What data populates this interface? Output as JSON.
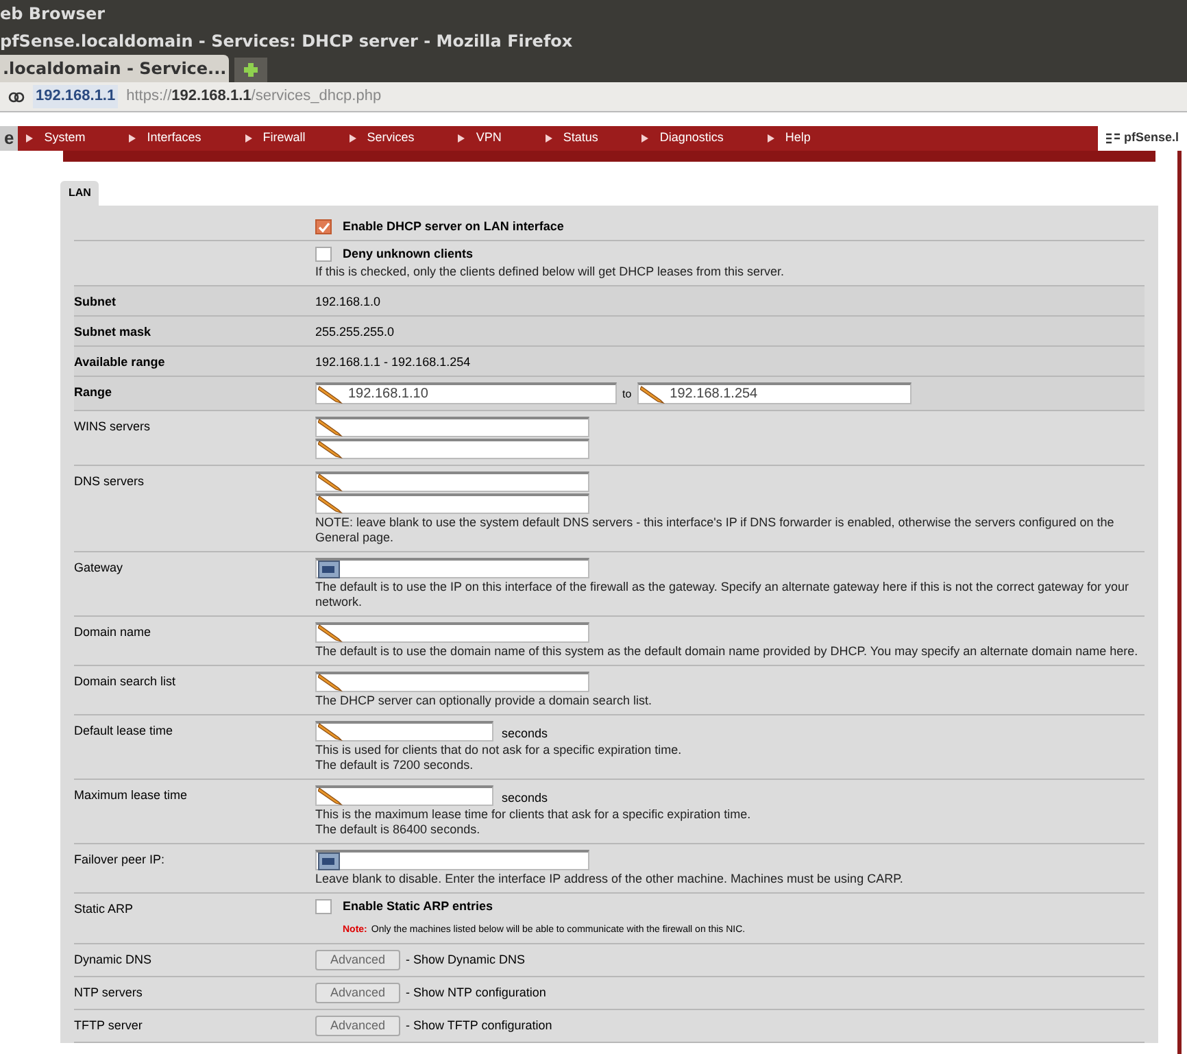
{
  "browser": {
    "app_title": "eb Browser",
    "window_title": "pfSense.localdomain - Services: DHCP server - Mozilla Firefox",
    "tab": ".localdomain - Service...",
    "url_host": "192.168.1.1",
    "url_scheme": "https://",
    "url_domain": "192.168.1.1",
    "url_path": "/services_dhcp.php"
  },
  "nav": {
    "logo": "e",
    "items": [
      "System",
      "Interfaces",
      "Firewall",
      "Services",
      "VPN",
      "Status",
      "Diagnostics",
      "Help"
    ],
    "host": "pfSense.l"
  },
  "tabs": [
    {
      "label": "LAN",
      "selected": true
    }
  ],
  "rows": [
    {
      "kind": "checkbox",
      "checked": true,
      "text": "Enable DHCP server on LAN interface"
    },
    {
      "kind": "checkbox",
      "checked": false,
      "text": "Deny unknown clients",
      "notes": [
        "If this is checked, only the clients defined below will get DHCP leases from this server."
      ]
    },
    {
      "kind": "text",
      "label": "Subnet",
      "required": true,
      "value": "192.168.1.0"
    },
    {
      "kind": "text",
      "label": "Subnet mask",
      "required": true,
      "value": "255.255.255.0"
    },
    {
      "kind": "text",
      "label": "Available range",
      "required": true,
      "value": "192.168.1.1 - 192.168.1.254"
    },
    {
      "kind": "range",
      "label": "Range",
      "required": true,
      "from": "192.168.1.10",
      "joiner": "to",
      "to": "192.168.1.254"
    },
    {
      "kind": "double-input",
      "label": "WINS servers",
      "required": false
    },
    {
      "kind": "double-input",
      "label": "DNS servers",
      "required": false,
      "notes": [
        "NOTE: leave blank to use the system default DNS servers - this interface's IP if DNS forwarder is enabled, otherwise the servers configured on the General page."
      ]
    },
    {
      "kind": "address-input",
      "label": "Gateway",
      "required": false,
      "notes": [
        "The default is to use the IP on this interface of the firewall as the gateway. Specify an alternate gateway here if this is not the correct gateway for your network."
      ]
    },
    {
      "kind": "input",
      "label": "Domain name",
      "required": false,
      "notes": [
        "The default is to use the domain name of this system as the default domain name provided by DHCP. You may specify an alternate domain name here."
      ]
    },
    {
      "kind": "input",
      "label": "Domain search list",
      "required": false,
      "notes": [
        "The DHCP server can optionally provide a domain search list."
      ]
    },
    {
      "kind": "duration",
      "label": "Default lease time",
      "required": false,
      "unit": "seconds",
      "notes": [
        "This is used for clients that do not ask for a specific expiration time.",
        "The default is 7200 seconds."
      ]
    },
    {
      "kind": "duration",
      "label": "Maximum lease time",
      "required": false,
      "unit": "seconds",
      "notes": [
        "This is the maximum lease time for clients that ask for a specific expiration time.",
        "The default is 86400 seconds."
      ]
    },
    {
      "kind": "address-input",
      "label": "Failover peer IP:",
      "required": false,
      "notes": [
        "Leave blank to disable. Enter the interface IP address of the other machine. Machines must be using CARP."
      ]
    },
    {
      "kind": "checkbox",
      "label": "Static ARP",
      "required": false,
      "checked": false,
      "text": "Enable Static ARP entries",
      "warning_label": "Note:",
      "warning": "Only the machines listed below will be able to communicate with the firewall on this NIC."
    },
    {
      "kind": "advanced",
      "label": "Dynamic DNS",
      "required": false,
      "button": "Advanced",
      "text": "- Show Dynamic DNS"
    },
    {
      "kind": "advanced",
      "label": "NTP servers",
      "required": false,
      "button": "Advanced",
      "text": "- Show NTP configuration"
    },
    {
      "kind": "advanced",
      "label": "TFTP server",
      "required": false,
      "button": "Advanced",
      "text": "- Show TFTP configuration"
    }
  ]
}
